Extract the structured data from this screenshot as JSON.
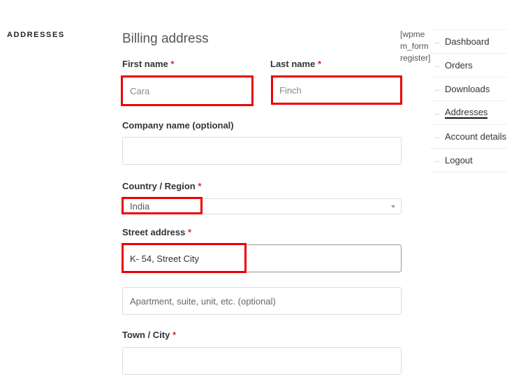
{
  "section": {
    "title": "ADDRESSES"
  },
  "form": {
    "heading": "Billing address",
    "required_mark": "*",
    "first_name": {
      "label": "First name",
      "value": "Cara"
    },
    "last_name": {
      "label": "Last name",
      "value": "Finch"
    },
    "company": {
      "label": "Company name (optional)",
      "value": ""
    },
    "country": {
      "label": "Country / Region",
      "value": "India"
    },
    "street": {
      "label": "Street address",
      "value": "K- 54, Street City",
      "placeholder2": "Apartment, suite, unit, etc. (optional)"
    },
    "town": {
      "label": "Town / City",
      "value": ""
    }
  },
  "shortcode": "[wpmem_form register]",
  "nav": {
    "arrow_icon": "→",
    "items": [
      {
        "label": "Dashboard"
      },
      {
        "label": "Orders"
      },
      {
        "label": "Downloads"
      },
      {
        "label": "Addresses",
        "active": true
      },
      {
        "label": "Account details"
      },
      {
        "label": "Logout"
      }
    ]
  },
  "highlight_color": "#ee0000"
}
